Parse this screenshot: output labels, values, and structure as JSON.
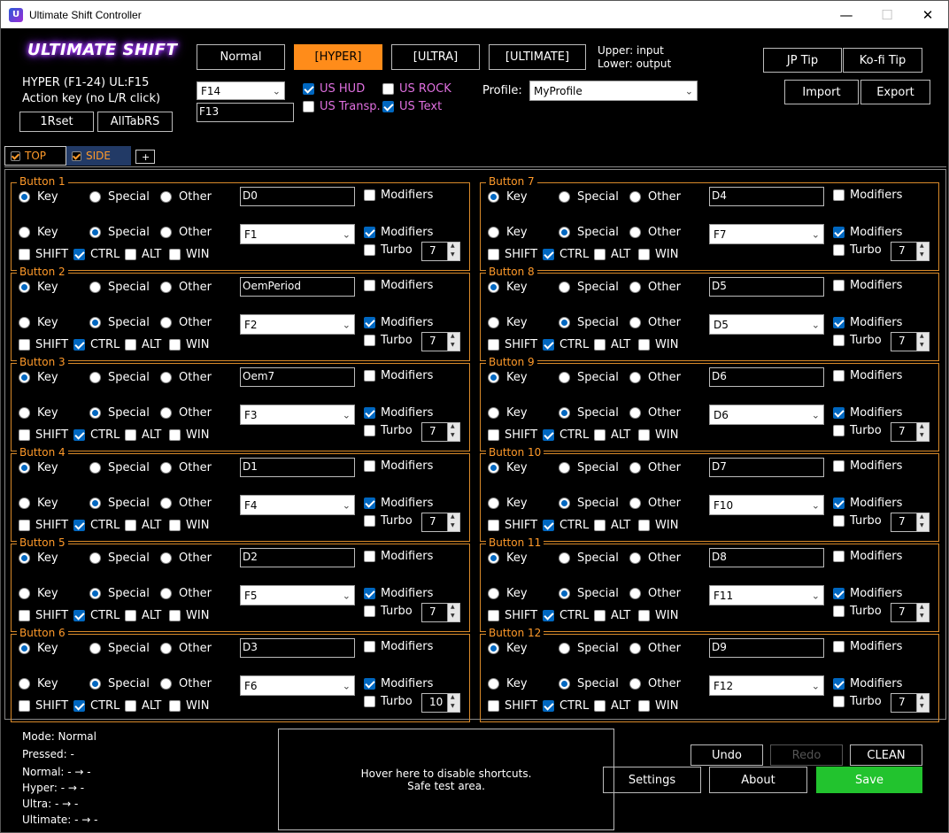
{
  "window": {
    "title": "Ultimate Shift Controller"
  },
  "header": {
    "logo": "ULTIMATE SHIFT",
    "info1": "HYPER (F1-24) UL:F15",
    "info2": "Action key (no L/R click)",
    "reset_btn": "1Rset",
    "alltab_btn": "AllTabRS",
    "modes": [
      "Normal",
      "[HYPER]",
      "[ULTRA]",
      "[ULTIMATE]"
    ],
    "upper_lower_1": "Upper: input",
    "upper_lower_2": "Lower: output",
    "jp_tip": "JP Tip",
    "kofi_tip": "Ko-fi Tip",
    "import": "Import",
    "export": "Export",
    "combo_key": "F14",
    "field_key": "F13",
    "chk_us_hud": "US HUD",
    "chk_us_rock": "US ROCK",
    "chk_us_transp": "US Transp.",
    "chk_us_text": "US Text",
    "profile_label": "Profile:",
    "profile_value": "MyProfile"
  },
  "tabs": {
    "top": "TOP",
    "side": "SIDE",
    "add": "+"
  },
  "labels": {
    "key": "Key",
    "special": "Special",
    "other": "Other",
    "modifiers": "Modifiers",
    "turbo": "Turbo",
    "shift": "SHIFT",
    "ctrl": "CTRL",
    "alt": "ALT",
    "win": "WIN"
  },
  "buttons": [
    {
      "name": "Button 1",
      "input": "D0",
      "output": "F1",
      "turbo": "7"
    },
    {
      "name": "Button 2",
      "input": "OemPeriod",
      "output": "F2",
      "turbo": "7"
    },
    {
      "name": "Button 3",
      "input": "Oem7",
      "output": "F3",
      "turbo": "7"
    },
    {
      "name": "Button 4",
      "input": "D1",
      "output": "F4",
      "turbo": "7"
    },
    {
      "name": "Button 5",
      "input": "D2",
      "output": "F5",
      "turbo": "7"
    },
    {
      "name": "Button 6",
      "input": "D3",
      "output": "F6",
      "turbo": "10"
    },
    {
      "name": "Button 7",
      "input": "D4",
      "output": "F7",
      "turbo": "7"
    },
    {
      "name": "Button 8",
      "input": "D5",
      "output": "D5",
      "turbo": "7"
    },
    {
      "name": "Button 9",
      "input": "D6",
      "output": "D6",
      "turbo": "7"
    },
    {
      "name": "Button 10",
      "input": "D7",
      "output": "F10",
      "turbo": "7"
    },
    {
      "name": "Button 11",
      "input": "D8",
      "output": "F11",
      "turbo": "7"
    },
    {
      "name": "Button 12",
      "input": "D9",
      "output": "F12",
      "turbo": "7"
    }
  ],
  "status": {
    "mode": "Mode: Normal",
    "pressed": "Pressed: -",
    "normal": "Normal: - → -",
    "hyper": "Hyper:  - → -",
    "ultra": "Ultra:  - → -",
    "ultimate": "Ultimate: - → -"
  },
  "safe_area": {
    "line1": "Hover here to disable shortcuts.",
    "line2": "Safe test area."
  },
  "footer": {
    "undo": "Undo",
    "redo": "Redo",
    "clean": "CLEAN",
    "settings": "Settings",
    "about": "About",
    "save": "Save"
  }
}
